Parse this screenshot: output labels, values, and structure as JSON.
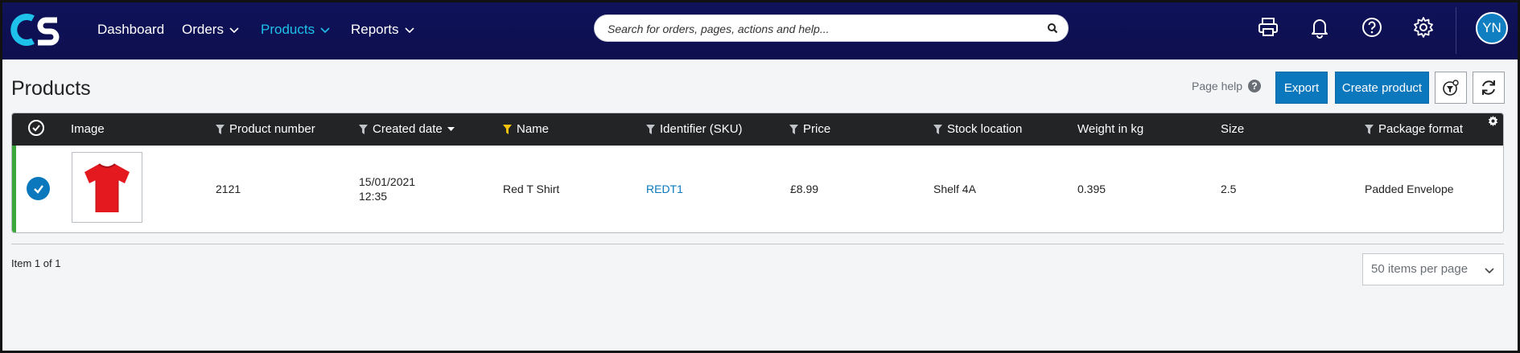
{
  "nav": {
    "items": [
      {
        "label": "Dashboard"
      },
      {
        "label": "Orders"
      },
      {
        "label": "Products"
      },
      {
        "label": "Reports"
      }
    ],
    "search_placeholder": "Search for orders, pages, actions and help...",
    "user_initials": "YN"
  },
  "header": {
    "title": "Products",
    "page_help": "Page help",
    "export_label": "Export",
    "create_label": "Create product"
  },
  "table": {
    "columns": [
      "Image",
      "Product number",
      "Created date",
      "Name",
      "Identifier (SKU)",
      "Price",
      "Stock location",
      "Weight in kg",
      "Size",
      "Package format"
    ],
    "rows": [
      {
        "product_number": "2121",
        "created_date": "15/01/2021",
        "created_time": "12:35",
        "name": "Red T Shirt",
        "sku": "REDT1",
        "price": "£8.99",
        "stock_location": "Shelf 4A",
        "weight": "0.395",
        "size": "2.5",
        "package_format": "Padded Envelope"
      }
    ]
  },
  "footer": {
    "item_count": "Item 1 of 1",
    "per_page": "50 items per page"
  },
  "colors": {
    "nav_bg": "#0d0f4f",
    "accent": "#1ec1ea",
    "primary": "#0b78be",
    "row_indicator": "#3aa83a",
    "table_header_bg": "#222426"
  }
}
